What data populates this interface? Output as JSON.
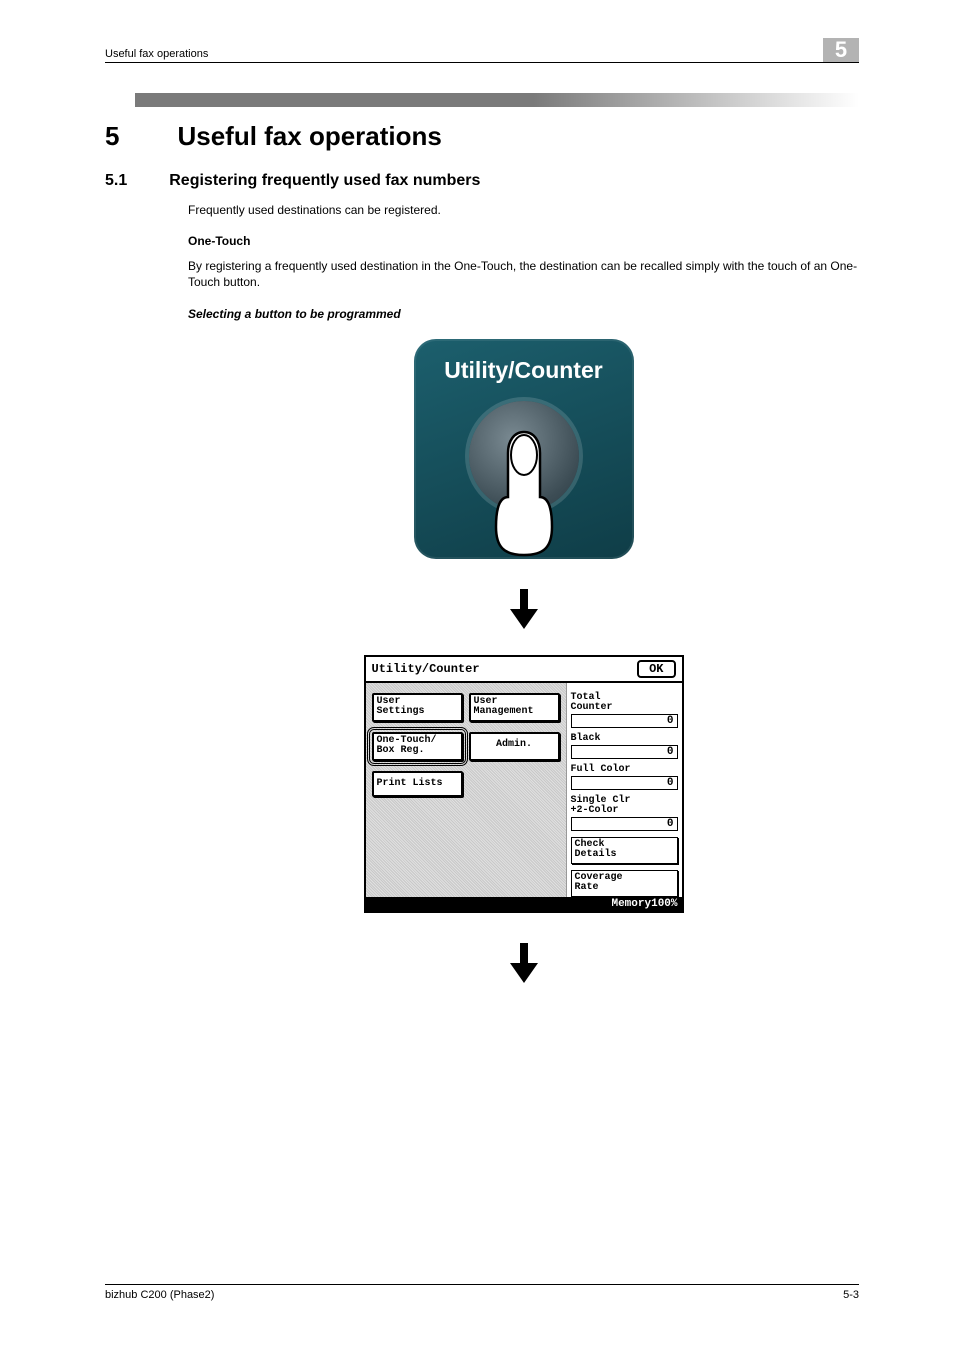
{
  "header": {
    "running_title": "Useful fax operations",
    "chapter_badge": "5"
  },
  "h1": {
    "num": "5",
    "title": "Useful fax operations"
  },
  "h2": {
    "num": "5.1",
    "title": "Registering frequently used fax numbers"
  },
  "intro": "Frequently used destinations can be registered.",
  "one_touch": {
    "heading": "One-Touch",
    "body": "By registering a frequently used destination in the One-Touch, the destination can be recalled simply with the touch of an One-Touch button."
  },
  "selecting_heading": "Selecting a button to be programmed",
  "utility_button": {
    "label": "Utility/Counter"
  },
  "lcd": {
    "title": "Utility/Counter",
    "ok": "OK",
    "buttons": {
      "user_settings": "User\nSettings",
      "user_management": "User\nManagement",
      "one_touch": "One-Touch/\nBox Reg.",
      "admin": "Admin.",
      "print_lists": "Print Lists"
    },
    "counters": {
      "total_label": "Total\nCounter",
      "total_value": "0",
      "black_label": "Black",
      "black_value": "0",
      "full_color_label": "Full Color",
      "full_color_value": "0",
      "single_label": "Single Clr\n+2-Color",
      "single_value": "0"
    },
    "right_buttons": {
      "check_details": "Check\nDetails",
      "coverage_rate": "Coverage\nRate"
    },
    "memory": "Memory100%"
  },
  "footer": {
    "left": "bizhub C200 (Phase2)",
    "right": "5-3"
  }
}
